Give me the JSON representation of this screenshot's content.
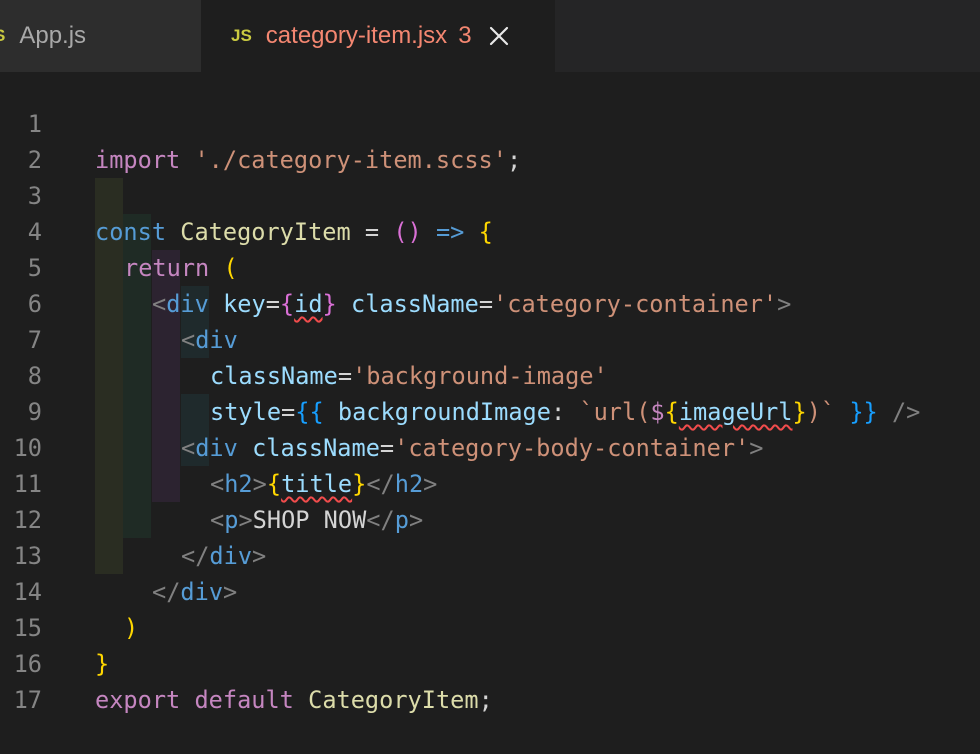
{
  "tabs": [
    {
      "icon": "S",
      "label": "App.js"
    },
    {
      "icon": "JS",
      "label": "category-item.jsx",
      "badge": "3",
      "close": "close-icon"
    }
  ],
  "line_numbers": [
    "1",
    "2",
    "3",
    "4",
    "5",
    "6",
    "7",
    "8",
    "9",
    "10",
    "11",
    "12",
    "13",
    "14",
    "15",
    "16",
    "17"
  ],
  "code": {
    "l1": {
      "import": "import",
      "path": "'./category-item.scss'",
      "semi": ";"
    },
    "l3": {
      "const": "const",
      "name": "CategoryItem",
      "eq": " = ",
      "paren": "()",
      "arrow": " => ",
      "brace": "{"
    },
    "l4": {
      "ret": "return",
      "paren": "("
    },
    "l5": {
      "lt": "<",
      "tag": "div",
      "attr1": "key",
      "eq1": "=",
      "ob": "{",
      "id": "id",
      "cb": "}",
      "attr2": "className",
      "eq2": "=",
      "val": "'category-container'",
      "gt": ">"
    },
    "l6": {
      "lt": "<",
      "tag": "div"
    },
    "l7": {
      "attr": "className",
      "eq": "=",
      "val": "'background-image'"
    },
    "l8": {
      "attr": "style",
      "eq": "=",
      "ob": "{{ ",
      "prop": "backgroundImage",
      "colon": ": ",
      "tpl1": "`url(",
      "dollar": "$",
      "ob2": "{",
      "var": "imageUrl",
      "cb2": "}",
      "tpl2": ")`",
      "cb": " }}",
      "close": " />"
    },
    "l9": {
      "lt": "<",
      "tag": "div",
      "attr": "className",
      "eq": "=",
      "val": "'category-body-container'",
      "gt": ">"
    },
    "l10": {
      "lt": "<",
      "tag": "h2",
      "gt": ">",
      "ob": "{",
      "var": "title",
      "cb": "}",
      "lt2": "</",
      "tag2": "h2",
      "gt2": ">"
    },
    "l11": {
      "lt": "<",
      "tag": "p",
      "gt": ">",
      "text": "SHOP NOW",
      "lt2": "</",
      "tag2": "p",
      "gt2": ">"
    },
    "l12": {
      "lt": "</",
      "tag": "div",
      "gt": ">"
    },
    "l13": {
      "lt": "</",
      "tag": "div",
      "gt": ">"
    },
    "l14": {
      "paren": ")"
    },
    "l15": {
      "brace": "}"
    },
    "l16": {
      "export": "export",
      "default": "default",
      "name": "CategoryItem",
      "semi": ";"
    }
  }
}
